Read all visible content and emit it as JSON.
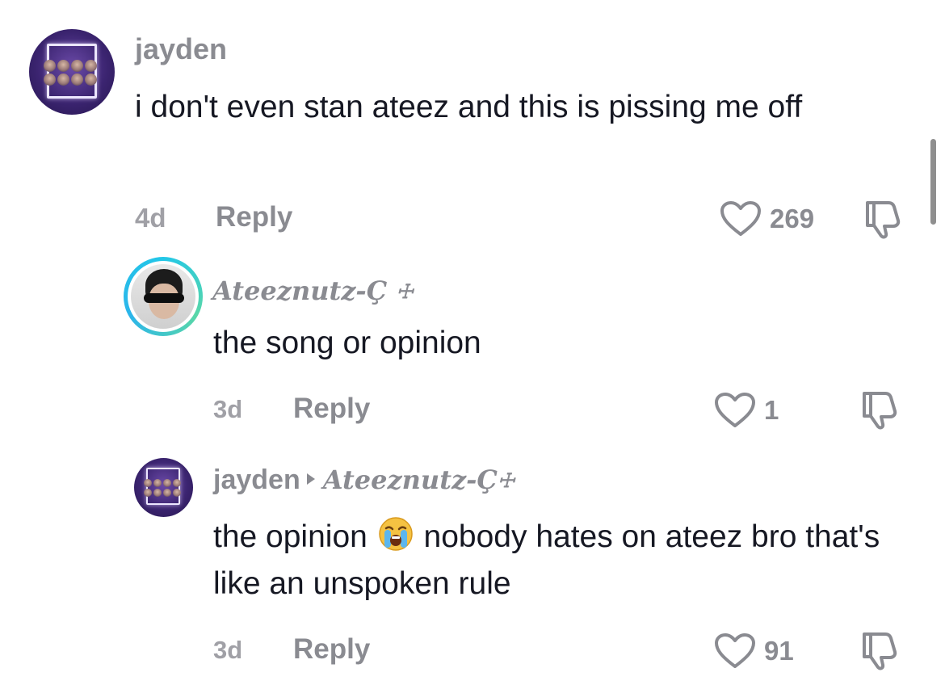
{
  "comments": [
    {
      "username": "jayden",
      "text": "i don't even stan ateez and this is pissing me off",
      "time": "4d",
      "reply_label": "Reply",
      "likes": "269"
    },
    {
      "username": "Ateeznutz-Ç",
      "username_cross": "☩",
      "text": "the song or opinion",
      "time": "3d",
      "reply_label": "Reply",
      "likes": "1"
    },
    {
      "username": "jayden",
      "reply_to": "Ateeznutz-Ç",
      "reply_to_cross": "☩",
      "text_before_emoji": "the opinion",
      "emoji": "loudly-crying-face",
      "text_after_emoji": "nobody hates on ateez bro that's like an unspoken rule",
      "time": "3d",
      "reply_label": "Reply",
      "likes": "91"
    }
  ],
  "icons": {
    "like": "heart-outline-icon",
    "dislike": "thumbs-down-icon",
    "reply_arrow": "triangle-right-icon"
  },
  "colors": {
    "text": "#161823",
    "muted": "#8a8b91",
    "ring": "#22c7e8"
  }
}
